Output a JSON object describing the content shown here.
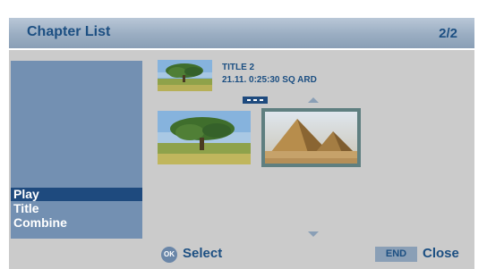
{
  "header": {
    "title": "Chapter List",
    "page": "2/2"
  },
  "menu": {
    "items": [
      {
        "label": "Play",
        "selected": true
      },
      {
        "label": "Title",
        "selected": false
      },
      {
        "label": "Combine",
        "selected": false
      }
    ]
  },
  "title_info": {
    "line1": "TITLE 2",
    "line2": "21.11.  0:25:30   SQ  ARD",
    "thumbnail": "tree-thumbnail"
  },
  "chapters": [
    {
      "thumbnail": "tree-thumbnail",
      "selected": false
    },
    {
      "thumbnail": "pyramids-thumbnail",
      "selected": true
    }
  ],
  "footer": {
    "ok_key": "OK",
    "select_label": "Select",
    "end_key": "END",
    "close_label": "Close"
  },
  "colors": {
    "header_text": "#1c4f82",
    "menu_panel": "#7390b2",
    "menu_selected": "#1e4a7e",
    "background": "#cbcbcb",
    "selected_border": "#5f7f80"
  }
}
